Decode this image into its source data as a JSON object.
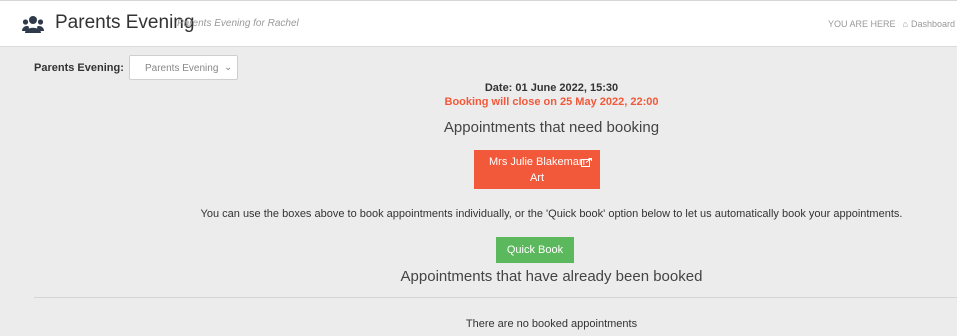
{
  "header": {
    "title": "Parents Evening",
    "subtitle": "Parents Evening for Rachel",
    "breadcrumb_label": "YOU ARE HERE",
    "breadcrumb_home": "Dashboard"
  },
  "filter": {
    "label": "Parents Evening:",
    "selected": "Parents Evening"
  },
  "event": {
    "date": "Date: 01 June 2022, 15:30",
    "closing": "Booking will close on 25 May 2022, 22:00"
  },
  "need_booking": {
    "heading": "Appointments that need booking",
    "appointments": [
      {
        "teacher": "Mrs Julie Blakeman",
        "subject": "Art"
      }
    ]
  },
  "info_text": "You can use the boxes above to book appointments individually, or the 'Quick book' option below to let us automatically book your appointments.",
  "quick_book_label": "Quick Book",
  "booked": {
    "heading": "Appointments that have already been booked",
    "empty_text": "There are no booked appointments"
  },
  "colors": {
    "accent_orange": "#f2593a",
    "quick_green": "#5cb85c",
    "background": "#ececec"
  }
}
